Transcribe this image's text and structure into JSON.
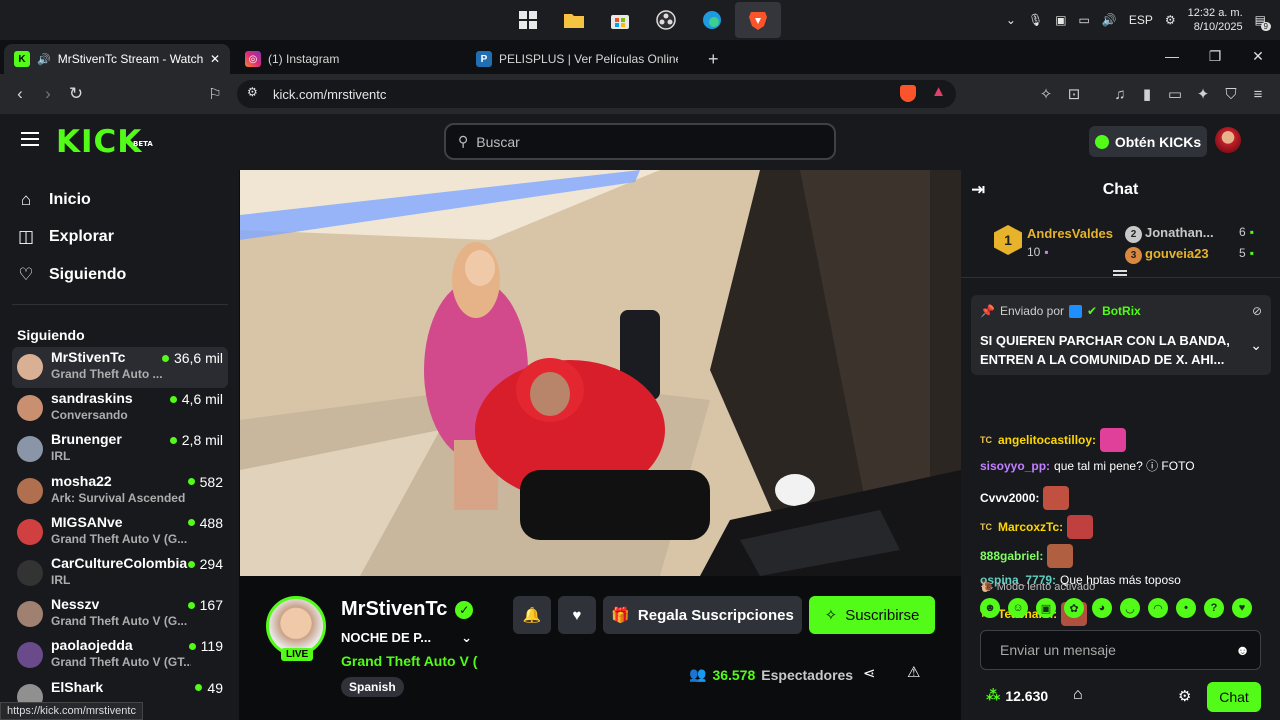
{
  "taskbar": {
    "apps": [
      "windows-start",
      "file-explorer",
      "microsoft-store",
      "obs",
      "edge",
      "brave"
    ],
    "tray": {
      "language": "ESP",
      "time": "12:32 a. m.",
      "date": "8/10/2025",
      "notifications": "9"
    }
  },
  "browser": {
    "tabs": [
      {
        "title": "MrStivenTc Stream - Watch Live",
        "icon": "K",
        "color": "#53fc18"
      },
      {
        "title": "(1) Instagram",
        "icon": "◎",
        "color": "#e1306c"
      },
      {
        "title": "PELISPLUS | Ver Películas Online Gratis",
        "icon": "P",
        "color": "#1f6fb2"
      }
    ],
    "url": "kick.com/mrstiventc",
    "status_url": "https://kick.com/mrstiventc"
  },
  "header": {
    "logo": "KICK",
    "logo_badge": "BETA",
    "search_placeholder": "Buscar",
    "kicks_label": "Obtén KICKs"
  },
  "sidebar": {
    "nav": [
      {
        "label": "Inicio",
        "icon": "home-icon"
      },
      {
        "label": "Explorar",
        "icon": "compass-icon"
      },
      {
        "label": "Siguiendo",
        "icon": "heart-icon"
      }
    ],
    "following_title": "Siguiendo",
    "channels": [
      {
        "name": "MrStivenTc",
        "game": "Grand Theft Auto ...",
        "viewers": "36,6 mil",
        "color": "#d9b094"
      },
      {
        "name": "sandraskins",
        "game": "Conversando",
        "viewers": "4,6 mil",
        "color": "#c89070"
      },
      {
        "name": "Brunenger",
        "game": "IRL",
        "viewers": "2,8 mil",
        "color": "#8a96a8"
      },
      {
        "name": "mosha22",
        "game": "Ark: Survival Ascended",
        "viewers": "582",
        "color": "#b07050"
      },
      {
        "name": "MIGSANve",
        "game": "Grand Theft Auto V (G...",
        "viewers": "488",
        "color": "#d04040"
      },
      {
        "name": "CarCultureColombia",
        "game": "IRL",
        "viewers": "294",
        "color": "#333333"
      },
      {
        "name": "Nesszv",
        "game": "Grand Theft Auto V (G...",
        "viewers": "167",
        "color": "#a08070"
      },
      {
        "name": "paolaojedda",
        "game": "Grand Theft Auto V (GT...",
        "viewers": "119",
        "color": "#6a4a8a"
      },
      {
        "name": "ElShark",
        "game": "",
        "viewers": "49",
        "color": "#909090"
      }
    ]
  },
  "stream": {
    "streamer": "MrStivenTc",
    "live_label": "LIVE",
    "title": "NOCHE DE P...",
    "category": "Grand Theft Auto V (",
    "tag": "Spanish",
    "gift_label": "Regala Suscripciones",
    "subscribe_label": "Suscribirse",
    "viewers_count": "36.578",
    "viewers_label": "Espectadores"
  },
  "chat": {
    "title": "Chat",
    "leaders": {
      "first": {
        "name": "AndresValdes",
        "rank": "1",
        "count": "10"
      },
      "second": {
        "name": "Jonathan...",
        "count": "6"
      },
      "third": {
        "name": "gouveia23",
        "count": "5"
      }
    },
    "pinned": {
      "sent_by": "Enviado por",
      "bot": "BotRix",
      "message": "SI QUIEREN PARCHAR CON LA BANDA, ENTREN A LA COMUNIDAD DE X. AHI..."
    },
    "messages": [
      {
        "user": "angelitocastilloy:",
        "text": "",
        "color": "#ffd700",
        "badge": "TC",
        "emote": "#e0409a"
      },
      {
        "user": "sisoyyo_pp:",
        "text": "que tal mi pene? ⓘ FOTO",
        "color": "#c080ff",
        "badge": "",
        "emote": ""
      },
      {
        "user": "Cvvv2000:",
        "text": "",
        "color": "#ffffff",
        "badge": "",
        "emote": "#c05040"
      },
      {
        "user": "MarcoxzTc:",
        "text": "",
        "color": "#ffd700",
        "badge": "TC",
        "emote": "#c04040"
      },
      {
        "user": "888gabriel:",
        "text": "",
        "color": "#80ff60",
        "badge": "",
        "emote": "#b06040"
      },
      {
        "user": "ospina_7779:",
        "text": "Que hptas más toposo",
        "color": "#60d0c0",
        "badge": "",
        "emote": ""
      },
      {
        "user": "Teachann:",
        "text": "",
        "color": "#ffd700",
        "badge": "TC",
        "emote": "#b05040"
      }
    ],
    "slow_mode": "Modo lento activado",
    "input_placeholder": "Enviar un mensaje",
    "points": "12.630",
    "send_label": "Chat"
  }
}
